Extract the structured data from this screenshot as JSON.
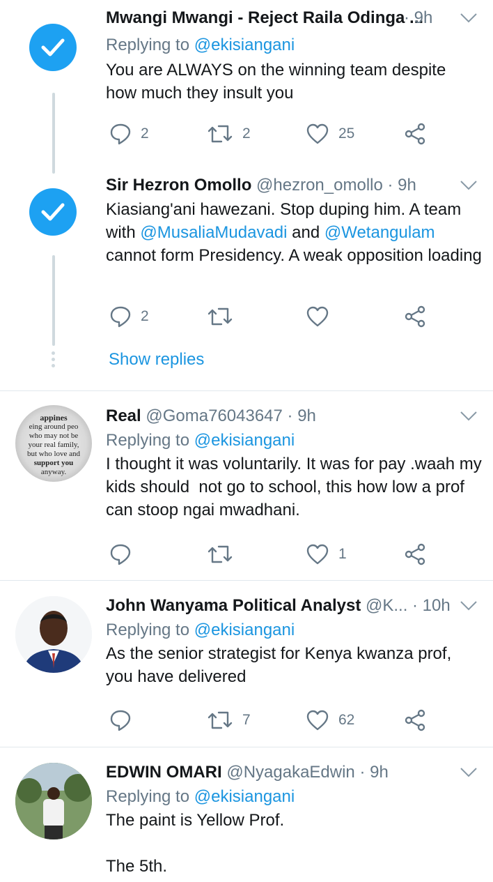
{
  "tweets": [
    {
      "name": "Mwangi Mwangi - Reject Raila Odinga ...",
      "handle": "",
      "time": "· 9h",
      "replying_label": "Replying to",
      "replying_to": "@ekisiangani",
      "text": "You are ALWAYS on the winning team despite how much they insult you",
      "reply_count": "2",
      "retweet_count": "2",
      "like_count": "25"
    },
    {
      "name": "Sir Hezron Omollo",
      "handle": "@hezron_omollo",
      "time": "· 9h",
      "text_a": "Kiasiang'ani hawezani. Stop duping him. A team with ",
      "mention1": "@MusaliaMudavadi",
      "text_b": " and ",
      "mention2": "@Wetangulam",
      "text_c": " cannot form Presidency. A weak opposition loading",
      "reply_count": "2",
      "retweet_count": "",
      "like_count": "",
      "show_replies": "Show replies"
    },
    {
      "name": "Real",
      "handle": "@Goma76043647",
      "time": "· 9h",
      "replying_label": "Replying to",
      "replying_to": "@ekisiangani",
      "text": "I thought it was voluntarily. It was for pay .waah my kids should  not go to school, this how low a prof can stoop ngai mwadhani.",
      "reply_count": "",
      "retweet_count": "",
      "like_count": "1",
      "avatar_text": [
        "appines",
        "eing around peo",
        "who may not be",
        "your real family,",
        "but who love and",
        "support you",
        "anyway."
      ]
    },
    {
      "name": "John Wanyama Political Analyst",
      "handle": "@K...",
      "time": "· 10h",
      "replying_label": "Replying to",
      "replying_to": "@ekisiangani",
      "text": "As the senior strategist for Kenya kwanza prof, you have delivered",
      "reply_count": "",
      "retweet_count": "7",
      "like_count": "62"
    },
    {
      "name": "EDWIN OMARI",
      "handle": "@NyagakaEdwin",
      "time": "· 9h",
      "replying_label": "Replying to",
      "replying_to": "@ekisiangani",
      "text": "The paint is Yellow Prof.\n\nThe 5th."
    }
  ],
  "colors": {
    "link": "#1b95e0",
    "muted": "#657786",
    "verified_blue": "#1da1f2"
  },
  "icons": [
    "verified-check-icon",
    "chevron-down-icon",
    "reply-icon",
    "retweet-icon",
    "like-icon",
    "share-icon"
  ]
}
